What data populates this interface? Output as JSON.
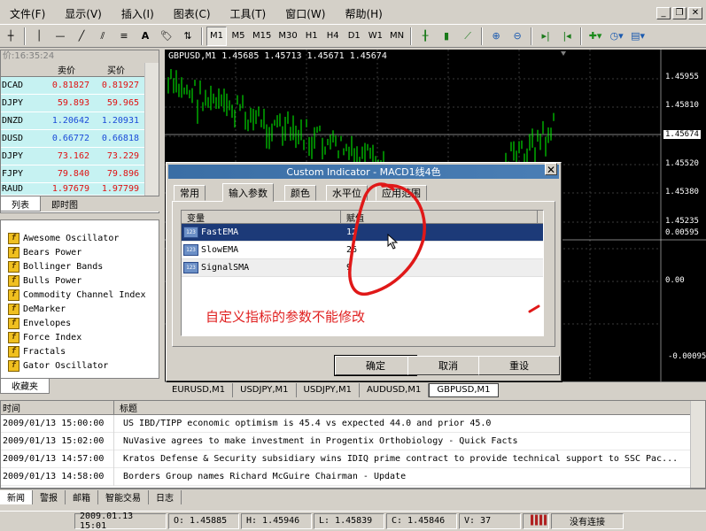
{
  "menu": {
    "items": [
      "文件(F)",
      "显示(V)",
      "插入(I)",
      "图表(C)",
      "工具(T)",
      "窗口(W)",
      "帮助(H)"
    ]
  },
  "toolbar": {
    "timeframes": [
      "M1",
      "M5",
      "M15",
      "M30",
      "H1",
      "H4",
      "D1",
      "W1",
      "MN"
    ],
    "active_timeframe": "M1"
  },
  "market_watch": {
    "title": "价:16:35:24",
    "headers": {
      "bid": "卖价",
      "ask": "买价"
    },
    "rows": [
      {
        "symbol": "DCAD",
        "bid": "0.81827",
        "ask": "0.81927",
        "dir": "down"
      },
      {
        "symbol": "DJPY",
        "bid": "59.893",
        "ask": "59.965",
        "dir": "down"
      },
      {
        "symbol": "DNZD",
        "bid": "1.20642",
        "ask": "1.20931",
        "dir": "up"
      },
      {
        "symbol": "DUSD",
        "bid": "0.66772",
        "ask": "0.66818",
        "dir": "up"
      },
      {
        "symbol": "DJPY",
        "bid": "73.162",
        "ask": "73.229",
        "dir": "down"
      },
      {
        "symbol": "FJPY",
        "bid": "79.840",
        "ask": "79.896",
        "dir": "down"
      },
      {
        "symbol": "RAUD",
        "bid": "1.97679",
        "ask": "1.97799",
        "dir": "down"
      }
    ],
    "tabs": [
      "列表",
      "即时图"
    ]
  },
  "navigator": {
    "items": [
      "Awesome Oscillator",
      "Bears Power",
      "Bollinger Bands",
      "Bulls Power",
      "Commodity Channel Index",
      "DeMarker",
      "Envelopes",
      "Force Index",
      "Fractals",
      "Gator Oscillator"
    ],
    "tab": "收藏夹"
  },
  "chart": {
    "info": "GBPUSD,M1  1.45685 1.45713 1.45671 1.45674",
    "price_labels": [
      "1.45955",
      "1.45810",
      "1.45674",
      "1.45520",
      "1.45380",
      "1.45235",
      "0.00595",
      "0.00",
      "-0.00095"
    ],
    "tabs": [
      "EURUSD,M1",
      "USDJPY,M1",
      "USDJPY,M1",
      "AUDUSD,M1",
      "GBPUSD,M1"
    ],
    "active_tab": "GBPUSD,M1"
  },
  "dialog": {
    "title": "Custom Indicator - MACD1线4色",
    "tabs": [
      "常用",
      "输入参数",
      "颜色",
      "水平位",
      "应用范围"
    ],
    "active_tab": "输入参数",
    "headers": {
      "variable": "变量",
      "value": "赋值"
    },
    "params": [
      {
        "name": "FastEMA",
        "value": "12"
      },
      {
        "name": "SlowEMA",
        "value": "26"
      },
      {
        "name": "SignalSMA",
        "value": "9"
      }
    ],
    "annotation": "自定义指标的参数不能修改",
    "buttons": {
      "ok": "确定",
      "cancel": "取消",
      "reset": "重设"
    }
  },
  "news": {
    "headers": {
      "time": "时间",
      "title": "标题"
    },
    "rows": [
      {
        "time": "2009/01/13 15:00:00",
        "title": "US IBD/TIPP economic optimism is 45.4 vs expected 44.0 and prior 45.0"
      },
      {
        "time": "2009/01/13 15:02:00",
        "title": "NuVasive agrees to make investment in Progentix Orthobiology - Quick Facts"
      },
      {
        "time": "2009/01/13 14:57:00",
        "title": "Kratos Defense & Security subsidiary wins IDIQ prime contract to provide technical support to SSC Pac..."
      },
      {
        "time": "2009/01/13 14:58:00",
        "title": "Borders Group names Richard McGuire Chairman - Update"
      }
    ],
    "tabs": [
      "新闻",
      "警报",
      "邮箱",
      "智能交易",
      "日志"
    ]
  },
  "status": {
    "datetime": "2009.01.13 15:01",
    "open": "O: 1.45885",
    "high": "H: 1.45946",
    "low": "L: 1.45839",
    "close": "C: 1.45846",
    "volume": "V: 37",
    "connection": "没有连接"
  }
}
